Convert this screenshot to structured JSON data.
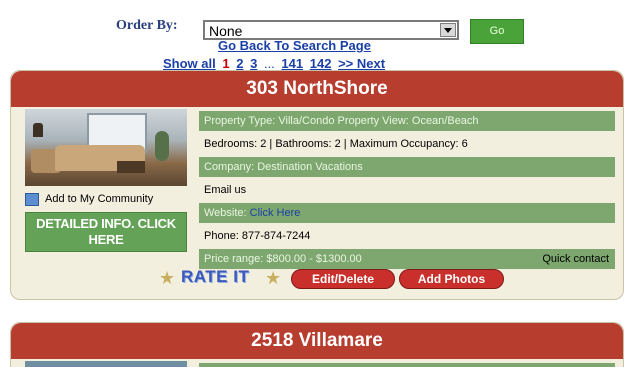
{
  "order": {
    "label": "Order By:",
    "selected": "None",
    "go_label": "Go"
  },
  "nav": {
    "back_link": "Go Back To Search Page",
    "pager": {
      "show_all": "Show all",
      "pages": [
        "1",
        "2",
        "3"
      ],
      "current": "1",
      "ellipsis": "...",
      "tail_pages": [
        "141",
        "142"
      ],
      "next": ">> Next"
    }
  },
  "listings": [
    {
      "title": "303 NorthShore",
      "add_community": "Add to My Community",
      "detailed_info": "DETAILED INFO. CLICK HERE",
      "rows": {
        "property_type": "Property Type: Villa/Condo Property View: Ocean/Beach",
        "rooms": "Bedrooms: 2 | Bathrooms: 2 | Maximum Occupancy: 6",
        "company": "Company: Destination Vacations",
        "email": "Email us",
        "website_label": "Website:",
        "website_link": "Click Here",
        "phone": "Phone: 877-874-7244",
        "price": "Price range: $800.00 - $1300.00",
        "quick_contact": "Quick contact"
      },
      "rate_label": "RATE IT",
      "edit_label": "Edit/Delete",
      "photos_label": "Add Photos"
    },
    {
      "title": "2518 Villamare"
    }
  ],
  "colors": {
    "title_bar": "#b73d2f",
    "green_row": "#7da76e",
    "card_bg": "#f3efdf",
    "link": "#1a3fa6",
    "go_button": "#4aa338"
  }
}
